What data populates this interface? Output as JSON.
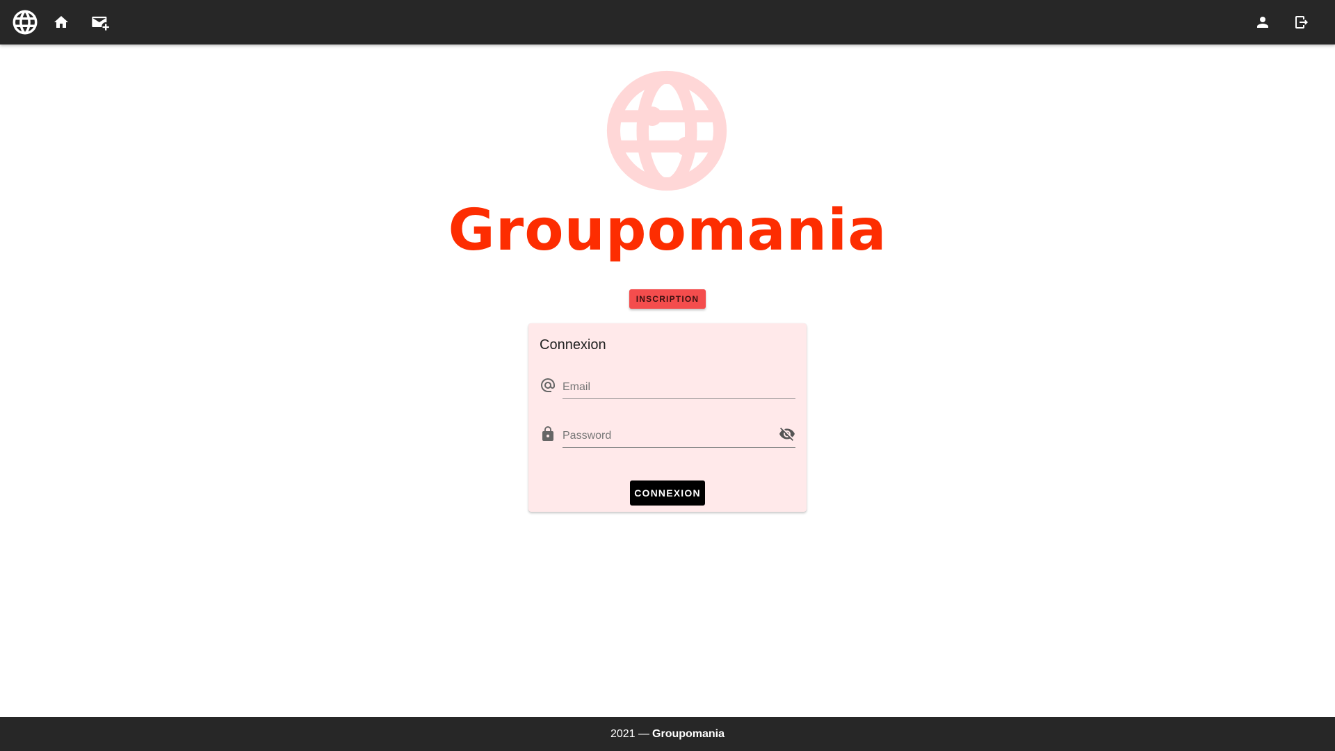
{
  "app": {
    "name": "Groupomania"
  },
  "colors": {
    "brand": "#fd2d01",
    "brand_light": "#ffd7d7",
    "topbar": "#272727",
    "card_bg": "#ffe9ea",
    "signup_bg": "#f44d4d",
    "signup_text": "#3a1010"
  },
  "topbar": {
    "left_icons": [
      "globe-logo-icon",
      "home-icon",
      "email-plus-icon"
    ],
    "right_icons": [
      "account-icon",
      "logout-icon"
    ]
  },
  "hero": {
    "logo_icon": "globe-icon",
    "title": "Groupomania"
  },
  "signup_button": {
    "label": "INSCRIPTION"
  },
  "login_card": {
    "title": "Connexion",
    "email": {
      "placeholder": "Email",
      "value": "",
      "icon": "at-icon"
    },
    "password": {
      "placeholder": "Password",
      "value": "",
      "icon": "lock-icon",
      "toggle_icon": "eye-off-icon"
    },
    "submit_label": "CONNEXION"
  },
  "footer": {
    "year_text": "2021 —",
    "brand": "Groupomania"
  }
}
